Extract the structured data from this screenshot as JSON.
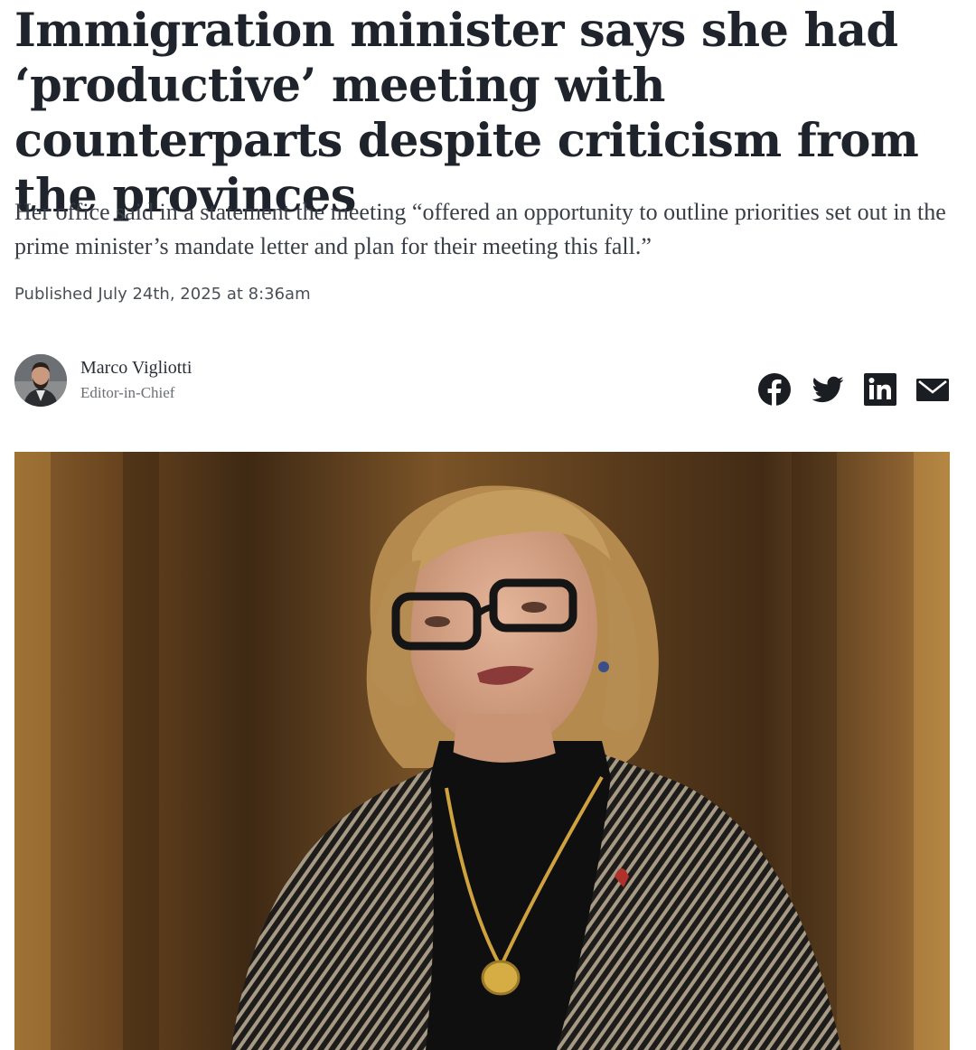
{
  "article": {
    "headline": "Immigration minister says she had ‘productive’ meeting with counterparts despite criticism from the provinces",
    "dek": "Her office said in a statement the meeting “offered an opportunity to outline priorities set out in the prime minister’s mandate letter and plan for their meeting this fall.”",
    "published": "Published July 24th, 2025 at 8:36am"
  },
  "author": {
    "name": "Marco Vigliotti",
    "role": "Editor-in-Chief"
  },
  "share": {
    "icons": [
      "facebook-icon",
      "twitter-icon",
      "linkedin-icon",
      "email-icon"
    ],
    "color": "#1a1d22"
  },
  "photo": {
    "subject": "woman speaking at podium, glasses, dark turtleneck, patterned jacket, gold pendant",
    "background_color": "#6e4a26"
  }
}
